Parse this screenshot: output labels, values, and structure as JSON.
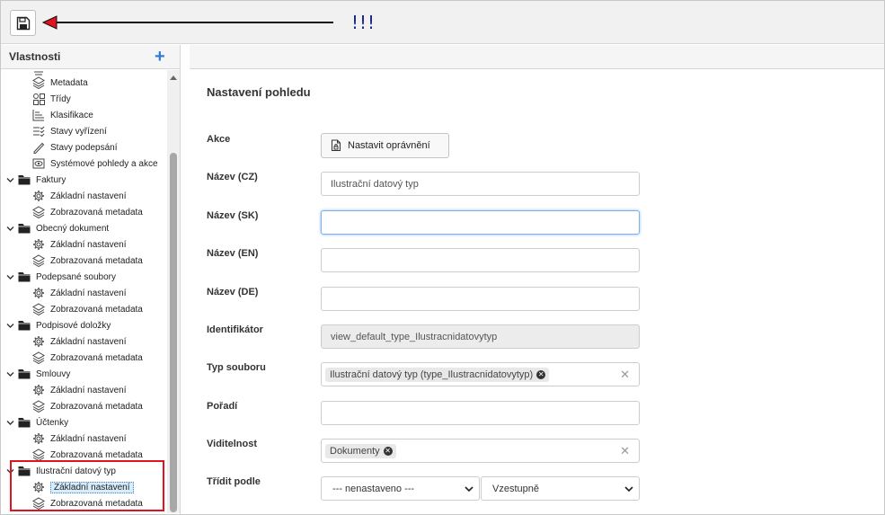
{
  "toolbar": {
    "annotation": "!!!"
  },
  "left_panel": {
    "title": "Vlastnosti",
    "top_items": [
      {
        "label": "Metadata",
        "icon": "layers-icon"
      },
      {
        "label": "Třídy",
        "icon": "classes-icon"
      },
      {
        "label": "Klasifikace",
        "icon": "classification-icon"
      },
      {
        "label": "Stavy vyřízení",
        "icon": "checklist-icon"
      },
      {
        "label": "Stavy podepsání",
        "icon": "pen-icon"
      },
      {
        "label": "Systémové pohledy a akce",
        "icon": "eye-icon"
      }
    ],
    "folders": [
      {
        "label": "Faktury",
        "children": [
          "Základní nastavení",
          "Zobrazovaná metadata"
        ]
      },
      {
        "label": "Obecný dokument",
        "children": [
          "Základní nastavení",
          "Zobrazovaná metadata"
        ]
      },
      {
        "label": "Podepsané soubory",
        "children": [
          "Základní nastavení",
          "Zobrazovaná metadata"
        ]
      },
      {
        "label": "Podpisové doložky",
        "children": [
          "Základní nastavení",
          "Zobrazovaná metadata"
        ]
      },
      {
        "label": "Smlouvy",
        "children": [
          "Základní nastavení",
          "Zobrazovaná metadata"
        ]
      },
      {
        "label": "Účtenky",
        "children": [
          "Základní nastavení",
          "Zobrazovaná metadata"
        ]
      },
      {
        "label": "Ilustrační datový typ",
        "children": [
          "Základní nastavení",
          "Zobrazovaná metadata"
        ]
      }
    ],
    "selected": "Ilustrační datový typ / Základní nastavení"
  },
  "form": {
    "title": "Nastavení pohledu",
    "akce_label": "Akce",
    "permissions_button": "Nastavit oprávnění",
    "name_cz_label": "Název (CZ)",
    "name_cz_value": "Ilustrační datový typ",
    "name_sk_label": "Název (SK)",
    "name_sk_value": "",
    "name_en_label": "Název (EN)",
    "name_en_value": "",
    "name_de_label": "Název (DE)",
    "name_de_value": "",
    "identifier_label": "Identifikátor",
    "identifier_value": "view_default_type_Ilustracnidatovytyp",
    "file_type_label": "Typ souboru",
    "file_type_tag": "Ilustrační datový typ (type_Ilustracnidatovytyp)",
    "order_label": "Pořadí",
    "order_value": "",
    "visibility_label": "Viditelnost",
    "visibility_tag": "Dokumenty",
    "sort_label": "Třídit podle",
    "sort_field": "--- nenastaveno ---",
    "sort_direction": "Vzestupně"
  },
  "colors": {
    "accent": "#2e7dd7",
    "highlight": "#e0141e",
    "annotation": "#1b2a88"
  }
}
